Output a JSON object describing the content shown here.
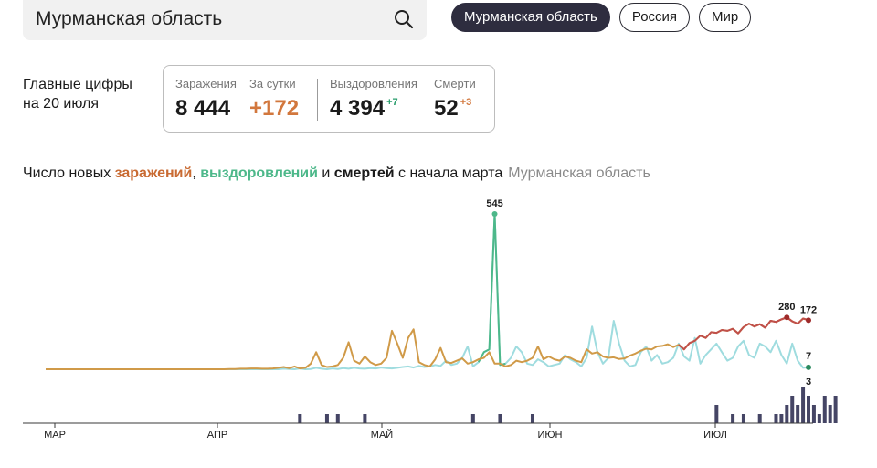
{
  "search": {
    "value": "Мурманская область"
  },
  "tabs": [
    {
      "label": "Мурманская область",
      "active": true
    },
    {
      "label": "Россия",
      "active": false
    },
    {
      "label": "Мир",
      "active": false
    }
  ],
  "heading": {
    "line1": "Главные цифры",
    "line2": "на 20 июля"
  },
  "stats": {
    "infections": {
      "label": "Заражения",
      "value": "8 444"
    },
    "daily": {
      "label": "За сутки",
      "value": "+172"
    },
    "recoveries": {
      "label": "Выздоровления",
      "value": "4 394",
      "delta": "+7"
    },
    "deaths": {
      "label": "Смерти",
      "value": "52",
      "delta": "+3"
    }
  },
  "chart_title": {
    "part1": "Число новых ",
    "infections": "заражений",
    "sep": ", ",
    "recoveries": "выздоровлений",
    "and": " и ",
    "deaths": "смертей",
    "rest": " с начала марта",
    "region": "Мурманская область"
  },
  "colors": {
    "accent_orange": "#c96b33",
    "accent_green": "#4db88a",
    "recovery_line": "#9fdcdf",
    "infection_line": "#d09a48",
    "infection_recent": "#c0504a",
    "deaths_bar": "#454565",
    "tab_active": "#2e2d3f"
  },
  "chart_data": {
    "type": "line",
    "x_axis_labels": [
      "МАР",
      "АПР",
      "МАЙ",
      "ИЮН",
      "ИЮЛ"
    ],
    "series": [
      {
        "name": "заражений",
        "values": [
          0,
          0,
          0,
          0,
          0,
          0,
          0,
          0,
          0,
          0,
          0,
          0,
          0,
          0,
          0,
          0,
          0,
          0,
          0,
          0,
          0,
          0,
          0,
          0,
          0,
          0,
          0,
          0,
          0,
          0,
          0,
          0,
          0,
          0,
          1,
          1,
          2,
          2,
          3,
          3,
          2,
          2,
          3,
          5,
          8,
          4,
          10,
          3,
          5,
          20,
          60,
          15,
          8,
          10,
          15,
          40,
          95,
          30,
          20,
          45,
          25,
          15,
          20,
          40,
          135,
          90,
          40,
          110,
          140,
          25,
          15,
          10,
          35,
          75,
          25,
          22,
          30,
          38,
          20,
          25,
          35,
          40,
          60,
          20,
          20,
          10,
          15,
          30,
          25,
          30,
          40,
          80,
          35,
          45,
          35,
          30,
          45,
          40,
          30,
          25,
          70,
          55,
          60,
          45,
          40,
          42,
          36,
          38,
          48,
          55,
          65,
          72,
          70,
          80,
          82,
          88,
          78,
          86,
          70,
          92,
          100,
          118,
          110,
          130,
          128,
          138,
          135,
          142,
          126,
          148,
          160,
          150,
          158,
          146,
          170,
          166,
          175,
          182,
          168,
          160,
          178,
          172
        ]
      },
      {
        "name": "выздоровлений",
        "values": [
          0,
          0,
          0,
          0,
          0,
          0,
          0,
          0,
          0,
          0,
          0,
          0,
          0,
          0,
          0,
          0,
          0,
          0,
          0,
          0,
          0,
          0,
          0,
          0,
          0,
          0,
          0,
          0,
          0,
          0,
          0,
          0,
          0,
          0,
          0,
          0,
          0,
          0,
          0,
          0,
          0,
          0,
          0,
          0,
          2,
          1,
          0,
          3,
          0,
          1,
          5,
          2,
          0,
          3,
          1,
          4,
          2,
          5,
          3,
          2,
          4,
          3,
          6,
          4,
          3,
          5,
          8,
          10,
          6,
          12,
          8,
          10,
          15,
          12,
          30,
          15,
          20,
          40,
          80,
          10,
          25,
          60,
          70,
          545,
          15,
          20,
          40,
          80,
          60,
          20,
          15,
          35,
          25,
          10,
          15,
          20,
          50,
          35,
          25,
          10,
          40,
          150,
          60,
          20,
          40,
          170,
          90,
          30,
          10,
          15,
          60,
          80,
          30,
          50,
          20,
          25,
          40,
          90,
          45,
          30,
          110,
          20,
          50,
          70,
          90,
          60,
          30,
          40,
          80,
          100,
          50,
          40,
          90,
          80,
          60,
          100,
          50,
          20,
          90,
          30,
          5,
          7
        ]
      }
    ],
    "deaths": [
      0,
      0,
      0,
      0,
      0,
      0,
      0,
      0,
      0,
      0,
      0,
      0,
      0,
      0,
      0,
      0,
      0,
      0,
      0,
      0,
      0,
      0,
      0,
      0,
      0,
      0,
      0,
      0,
      0,
      0,
      0,
      0,
      0,
      0,
      0,
      0,
      0,
      0,
      0,
      0,
      0,
      0,
      0,
      0,
      0,
      0,
      0,
      1,
      0,
      0,
      0,
      0,
      1,
      0,
      1,
      0,
      0,
      0,
      0,
      1,
      0,
      0,
      0,
      0,
      0,
      0,
      0,
      0,
      0,
      0,
      0,
      0,
      0,
      0,
      0,
      0,
      0,
      0,
      0,
      1,
      0,
      0,
      0,
      0,
      1,
      0,
      0,
      0,
      0,
      0,
      1,
      0,
      0,
      0,
      0,
      0,
      0,
      0,
      0,
      0,
      0,
      0,
      0,
      0,
      0,
      0,
      0,
      0,
      0,
      0,
      0,
      0,
      0,
      0,
      0,
      0,
      0,
      0,
      0,
      0,
      0,
      0,
      0,
      0,
      2,
      0,
      0,
      1,
      0,
      1,
      0,
      0,
      1,
      0,
      0,
      1,
      1,
      2,
      3,
      2,
      4,
      3,
      2,
      1,
      3,
      2,
      3
    ],
    "labels": {
      "infections_peak": "280",
      "recoveries_peak": "545",
      "infections_last": "172",
      "recoveries_last": "7",
      "deaths_last": "3"
    },
    "grid": false
  }
}
